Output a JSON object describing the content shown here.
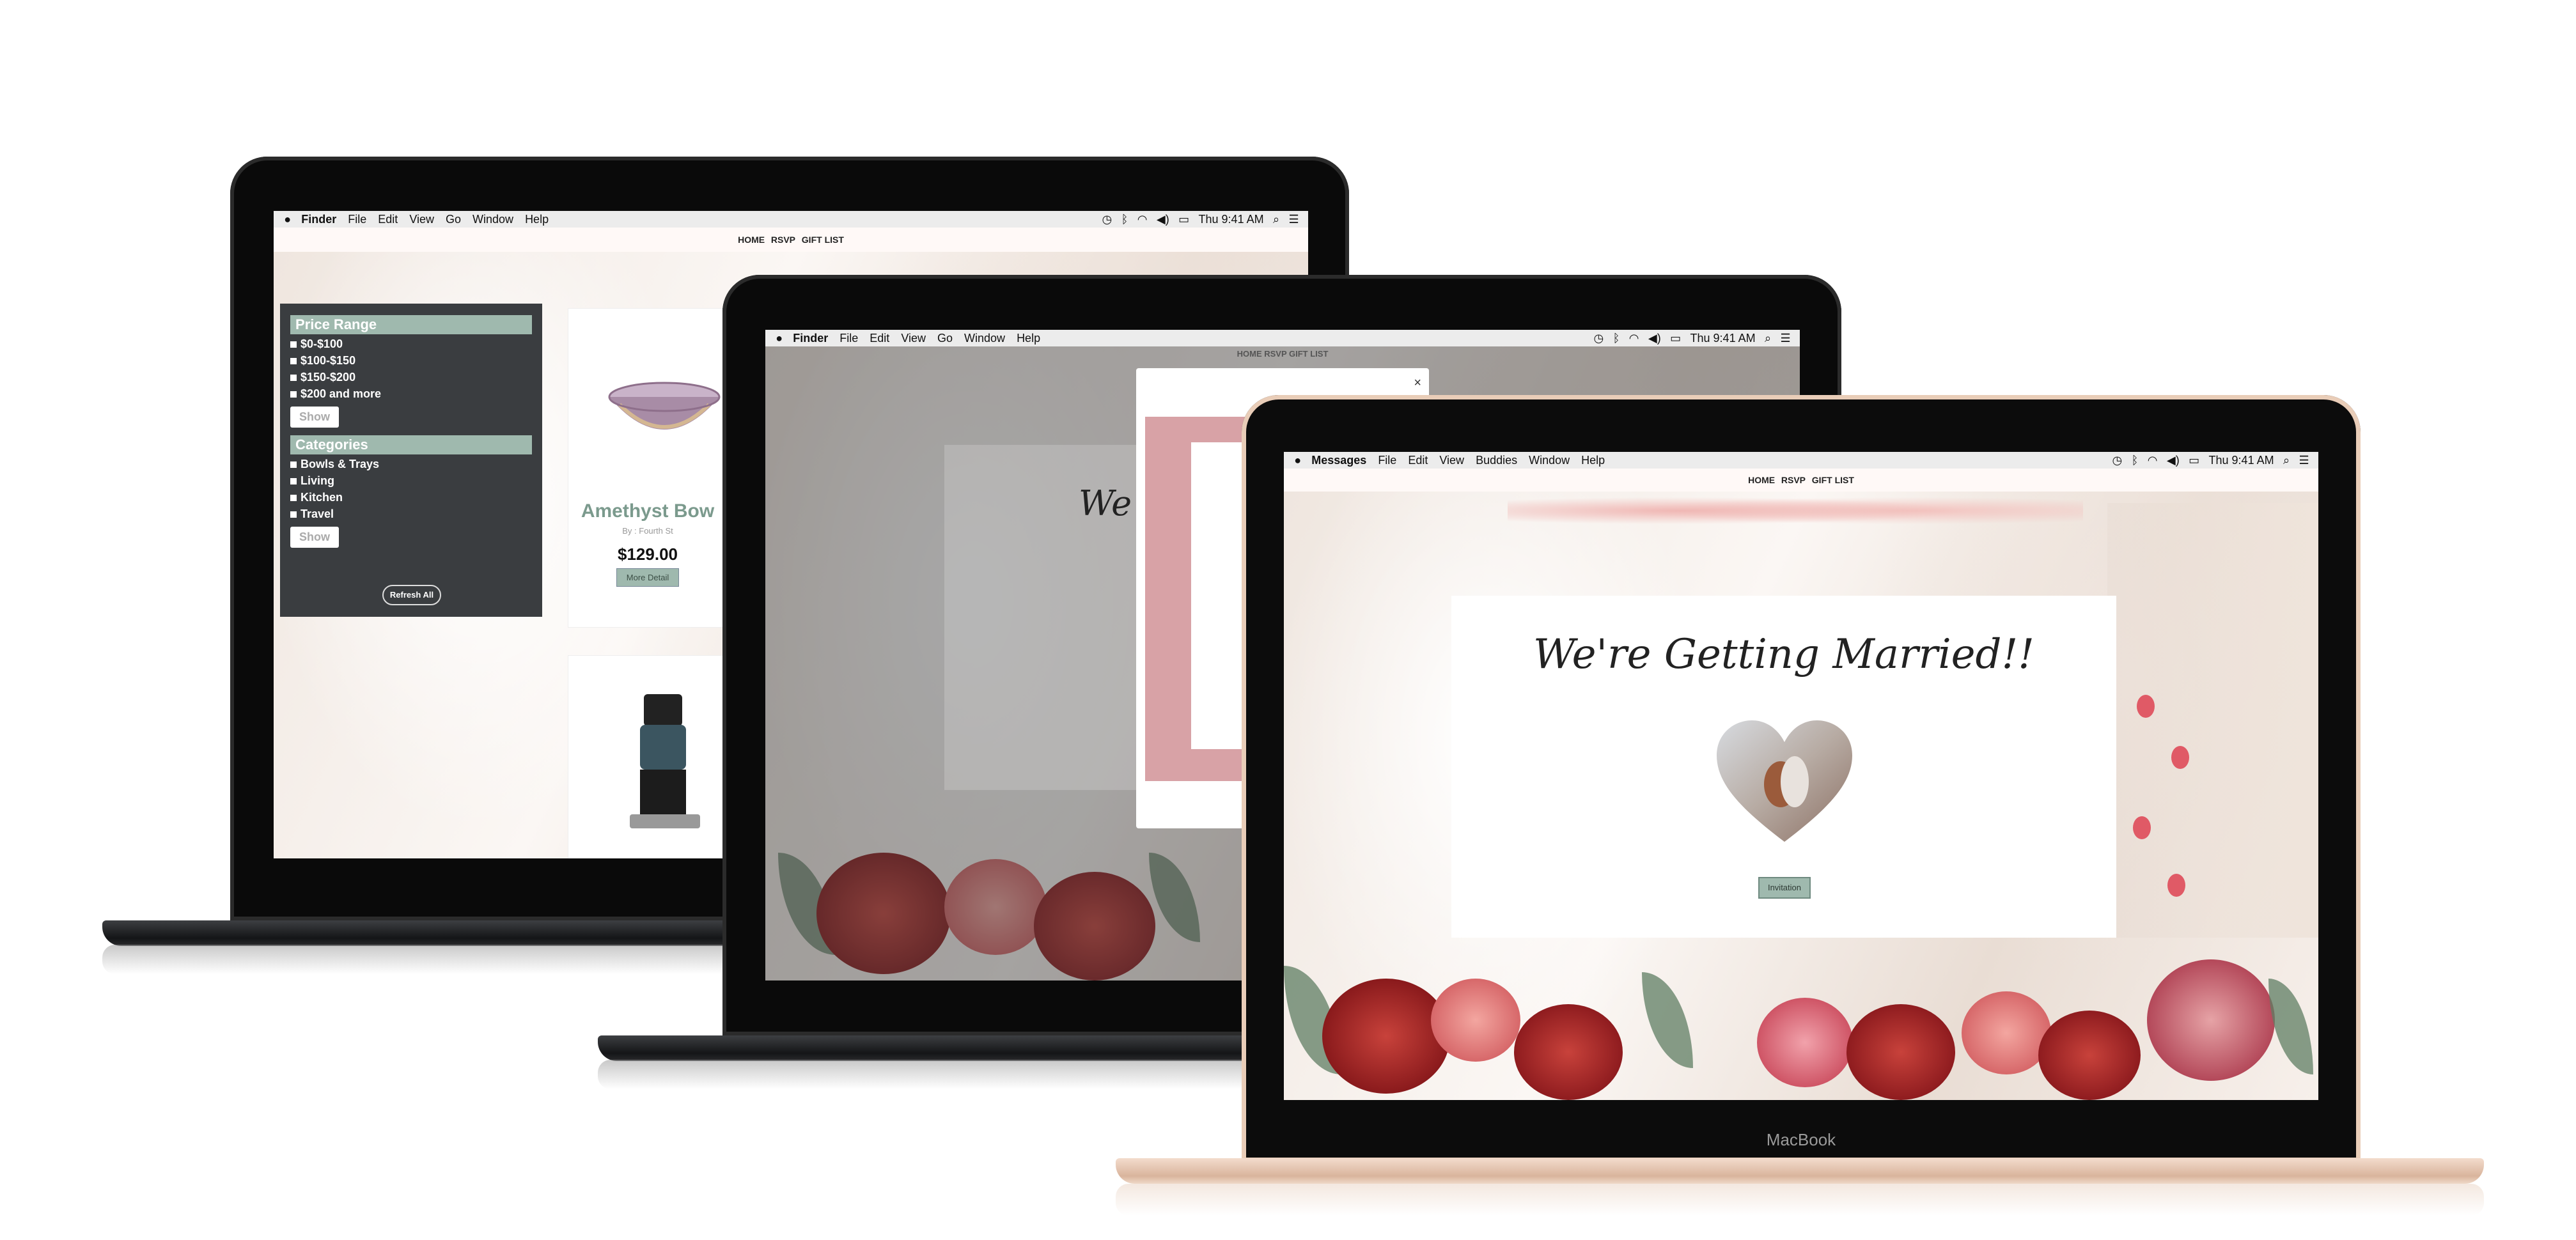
{
  "colors": {
    "accent": "#9fb9ae",
    "panel": "#3a3d40",
    "menubar": "#ececec",
    "gold": "#e9cdb8"
  },
  "laptop_back": {
    "menubar": {
      "apple_icon": "apple-icon",
      "app": "Finder",
      "items": [
        "File",
        "Edit",
        "View",
        "Go",
        "Window",
        "Help"
      ],
      "time": "Thu 9:41 AM"
    },
    "nav": [
      "HOME",
      "RSVP",
      "GIFT LIST"
    ],
    "filters": {
      "price_heading": "Price Range",
      "price_items": [
        "$0-$100",
        "$100-$150",
        "$150-$200",
        "$200 and more"
      ],
      "show": "Show",
      "category_heading": "Categories",
      "category_items": [
        "Bowls & Trays",
        "Living",
        "Kitchen",
        "Travel"
      ],
      "refresh": "Refresh All"
    },
    "product": {
      "title": "Amethyst Bow",
      "by": "By : Fourth St",
      "price": "$129.00",
      "detail": "More Detail"
    }
  },
  "laptop_middle": {
    "menubar": {
      "app": "Finder",
      "items": [
        "File",
        "Edit",
        "View",
        "Go",
        "Window",
        "Help"
      ],
      "time": "Thu 9:41 AM"
    },
    "nav": "HOME  RSVP  GIFT LIST",
    "headline_fragment": "We",
    "modal_close": "×"
  },
  "laptop_front": {
    "menubar": {
      "app": "Messages",
      "items": [
        "File",
        "Edit",
        "View",
        "Buddies",
        "Window",
        "Help"
      ],
      "time": "Thu 9:41 AM"
    },
    "nav": [
      "HOME",
      "RSVP",
      "GIFT LIST"
    ],
    "headline": "We're Getting Married!!",
    "button": "Invitation",
    "chin_label": "MacBook"
  }
}
